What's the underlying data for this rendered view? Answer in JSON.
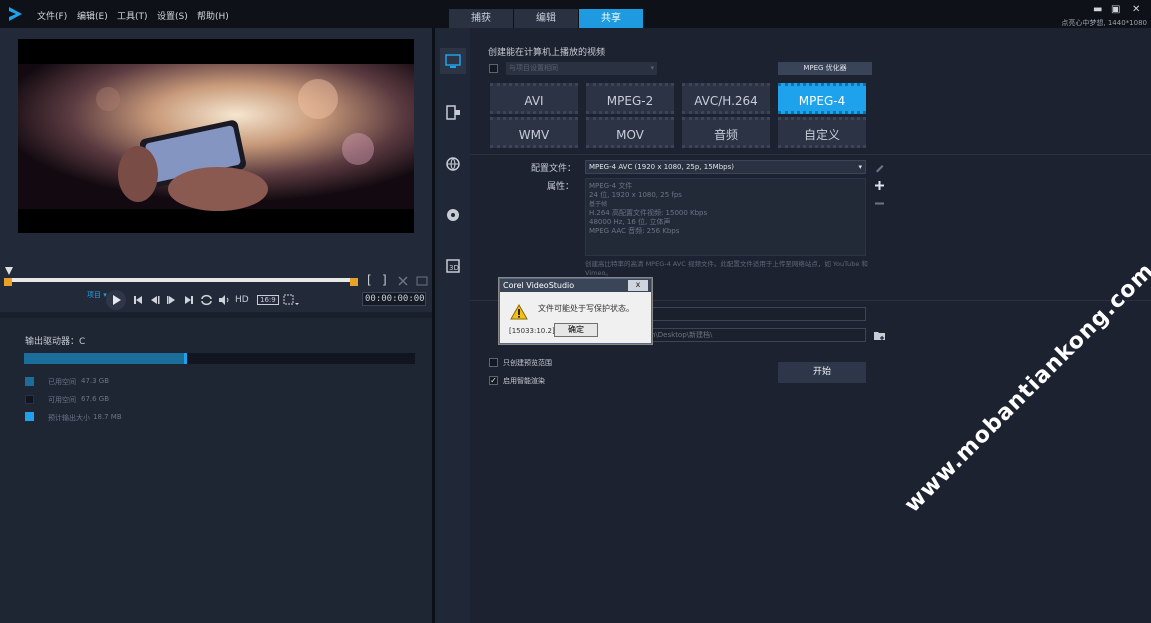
{
  "menu": {
    "items": [
      "文件(F)",
      "编辑(E)",
      "工具(T)",
      "设置(S)",
      "帮助(H)"
    ]
  },
  "tabs": [
    "捕获",
    "编辑",
    "共享"
  ],
  "status": "点亮心中梦想, 1440*1080",
  "window": {
    "min": "▬",
    "max": "▣",
    "close": "✕"
  },
  "player": {
    "project_label": "项目 ▾",
    "hd_label": "HD",
    "aspect": "16:9",
    "timecode": "00:00:00:00",
    "in_mark": "[",
    "out_mark": "]"
  },
  "drive": {
    "title": "输出驱动器：C",
    "fill_ratio": 0.41,
    "legend": [
      {
        "label": "已用空间",
        "value": "47.3 GB",
        "color": "#1b6e9a"
      },
      {
        "label": "可用空间",
        "value": "67.6 GB",
        "color": "#101520"
      },
      {
        "label": "预计输出大小",
        "value": "18.7 MB",
        "color": "#1ea2ec"
      }
    ]
  },
  "share": {
    "heading": "创建能在计算机上播放的视频",
    "dropdown_placeholder": "与项目设置相同",
    "mpeg_opt": "MPEG 优化器",
    "formats": [
      "AVI",
      "MPEG-2",
      "AVC/H.264",
      "MPEG-4",
      "WMV",
      "MOV",
      "音频",
      "自定义"
    ],
    "selected": "MPEG-4",
    "profile_label": "配置文件：",
    "profile_value": "MPEG-4 AVC (1920 x 1080, 25p, 15Mbps)",
    "attr_label": "属性：",
    "attributes": [
      "MPEG-4 文件",
      "24 位, 1920 x 1080, 25 fps",
      "基于帧",
      "H.264 高配置文件视频: 15000 Kbps",
      "48000 Hz, 16 位, 立体声",
      "MPEG AAC 音频: 256 Kbps"
    ],
    "desc": "创建高比特率的高清 MPEG-4 AVC 视频文件。此配置文件适用于上传至网络站点，如 YouTube 和 Vimeo。",
    "folder_path": "n\\Desktop\\新建档\\",
    "chk1": "只创建预览范围",
    "chk2": "启用智能渲染",
    "start": "开始"
  },
  "dialog": {
    "title": "Corel VideoStudio",
    "message": "文件可能处于写保护状态。",
    "code": "[15033:10.2]",
    "ok": "确定",
    "close": "x"
  },
  "watermark": "www.mobantiankong.com"
}
